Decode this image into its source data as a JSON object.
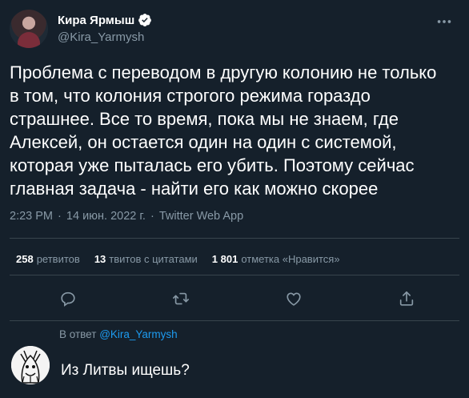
{
  "author": {
    "display_name": "Кира Ярмыш",
    "handle": "@Kira_Yarmysh",
    "verified": true
  },
  "tweet": {
    "text": "Проблема с переводом в другую колонию не только\nв том, что колония строгого режима гораздо\nстрашнее. Все то время, пока мы не знаем, где\nАлексей, он остается один на один с системой,\nкоторая уже пыталась его убить. Поэтому сейчас\nглавная задача - найти его как можно скорее",
    "time": "2:23 PM",
    "date": "14 июн. 2022 г.",
    "separator": "·",
    "source": "Twitter Web App"
  },
  "stats": {
    "retweets_count": "258",
    "retweets_label": "ретвитов",
    "quotes_count": "13",
    "quotes_label": "твитов с цитатами",
    "likes_count": "1 801",
    "likes_label": "отметка «Нравится»"
  },
  "actions": [
    "reply-icon",
    "retweet-icon",
    "like-icon",
    "share-icon"
  ],
  "reply": {
    "prefix": "В ответ",
    "mention": "@Kira_Yarmysh",
    "text": "Из Литвы ищешь?"
  },
  "colors": {
    "background": "#15202b",
    "text": "#ffffff",
    "muted": "#8899a6",
    "accent": "#1d9bf0",
    "divider": "#38444d"
  }
}
